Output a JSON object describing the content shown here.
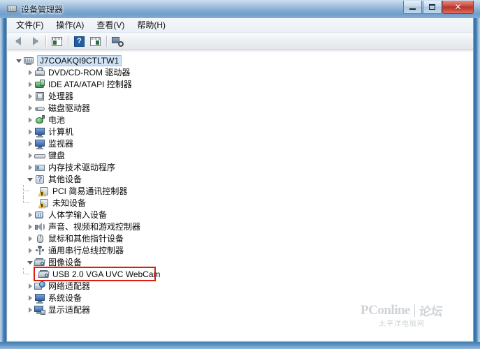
{
  "window": {
    "title": "设备管理器",
    "title_icon": "device-manager-icon",
    "buttons": {
      "minimize": "minimize-button",
      "maximize": "maximize-button",
      "close_label": "✕"
    }
  },
  "menu": {
    "items": [
      {
        "label": "文件(F)",
        "name": "menu-file"
      },
      {
        "label": "操作(A)",
        "name": "menu-action"
      },
      {
        "label": "查看(V)",
        "name": "menu-view"
      },
      {
        "label": "帮助(H)",
        "name": "menu-help"
      }
    ]
  },
  "toolbar": {
    "buttons": [
      {
        "name": "back-button",
        "icon": "back-arrow-icon"
      },
      {
        "name": "forward-button",
        "icon": "forward-arrow-icon"
      },
      {
        "name": "show-hide-console-tree-button",
        "icon": "console-tree-icon"
      },
      {
        "name": "help-button",
        "icon": "question-mark-icon"
      },
      {
        "name": "properties-button",
        "icon": "properties-icon"
      },
      {
        "name": "scan-for-hardware-changes-button",
        "icon": "scan-hardware-icon"
      }
    ]
  },
  "tree": {
    "root": {
      "label": "J7COAKQI9CTLTW1",
      "icon": "computer-icon",
      "expanded": true,
      "selected": true
    },
    "nodes": [
      {
        "label": "DVD/CD-ROM 驱动器",
        "icon": "dvd-drive-icon",
        "expanded": false,
        "level": 1
      },
      {
        "label": "IDE ATA/ATAPI 控制器",
        "icon": "ide-controller-icon",
        "expanded": false,
        "level": 1
      },
      {
        "label": "处理器",
        "icon": "processor-icon",
        "expanded": false,
        "level": 1
      },
      {
        "label": "磁盘驱动器",
        "icon": "disk-drive-icon",
        "expanded": false,
        "level": 1
      },
      {
        "label": "电池",
        "icon": "battery-icon",
        "expanded": false,
        "level": 1
      },
      {
        "label": "计算机",
        "icon": "computer-node-icon",
        "expanded": false,
        "level": 1
      },
      {
        "label": "监视器",
        "icon": "monitor-icon",
        "expanded": false,
        "level": 1
      },
      {
        "label": "键盘",
        "icon": "keyboard-icon",
        "expanded": false,
        "level": 1
      },
      {
        "label": "内存技术驱动程序",
        "icon": "memory-technology-driver-icon",
        "expanded": false,
        "level": 1
      },
      {
        "label": "其他设备",
        "icon": "other-devices-icon",
        "expanded": true,
        "level": 1
      },
      {
        "label": "PCI 简易通讯控制器",
        "icon": "warning-device-icon",
        "expanded": false,
        "level": 2,
        "warning": true
      },
      {
        "label": "未知设备",
        "icon": "warning-device-icon",
        "expanded": false,
        "level": 2,
        "warning": true,
        "last_child": true
      },
      {
        "label": "人体学输入设备",
        "icon": "human-interface-device-icon",
        "expanded": false,
        "level": 1
      },
      {
        "label": "声音、视频和游戏控制器",
        "icon": "speaker-icon",
        "expanded": false,
        "level": 1
      },
      {
        "label": "鼠标和其他指针设备",
        "icon": "mouse-icon",
        "expanded": false,
        "level": 1
      },
      {
        "label": "通用串行总线控制器",
        "icon": "usb-controller-icon",
        "expanded": false,
        "level": 1
      },
      {
        "label": "图像设备",
        "icon": "imaging-device-icon",
        "expanded": true,
        "level": 1
      },
      {
        "label": "USB 2.0 VGA UVC WebCam",
        "icon": "webcam-icon",
        "expanded": false,
        "level": 2,
        "last_child": true,
        "highlighted": true
      },
      {
        "label": "网络适配器",
        "icon": "network-adapter-icon",
        "expanded": false,
        "level": 1
      },
      {
        "label": "系统设备",
        "icon": "system-device-icon",
        "expanded": false,
        "level": 1
      },
      {
        "label": "显示适配器",
        "icon": "display-adapter-icon",
        "expanded": false,
        "level": 1
      }
    ]
  },
  "annotation": {
    "name": "red-highlight-box",
    "target": "USB 2.0 VGA UVC WebCam",
    "color": "#d81f10"
  },
  "watermark": {
    "main": "PConline",
    "forum": "论坛",
    "sub": "太平洋电脑网"
  }
}
